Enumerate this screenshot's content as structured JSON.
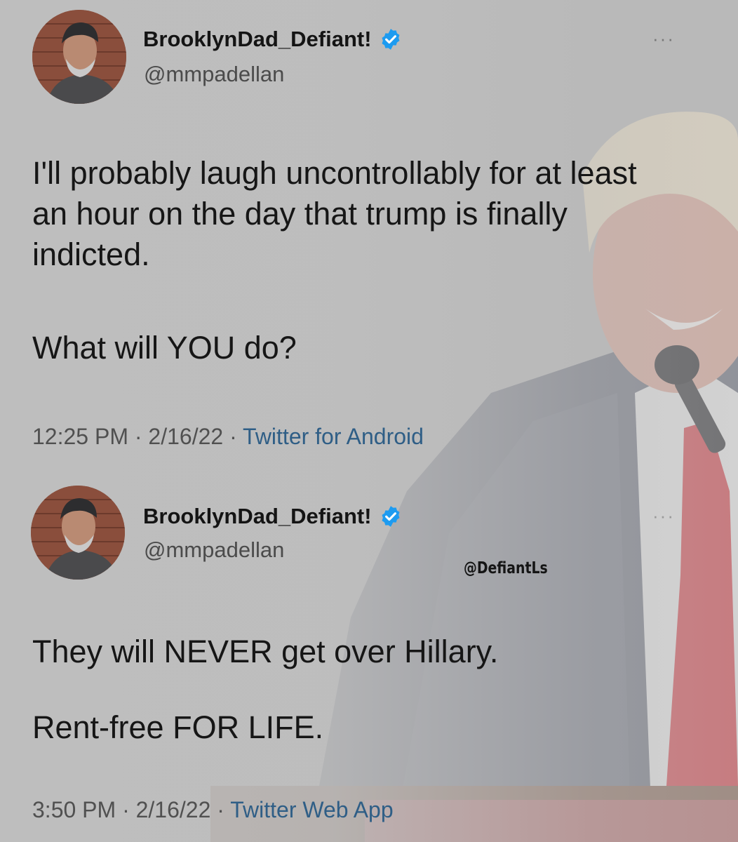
{
  "tweets": [
    {
      "display_name": "BrooklynDad_Defiant!",
      "handle": "@mmpadellan",
      "paragraphs": [
        "I'll probably laugh uncontrollably for at least an hour on the day that trump is finally indicted.",
        "What will YOU do?"
      ],
      "time": "12:25 PM",
      "date": "2/16/22",
      "separator": "·",
      "source": "Twitter for Android",
      "more": "···"
    },
    {
      "display_name": "BrooklynDad_Defiant!",
      "handle": "@mmpadellan",
      "paragraphs": [
        "They will NEVER get over Hillary.",
        "Rent-free FOR LIFE."
      ],
      "time": "3:50 PM",
      "date": "2/16/22",
      "separator": "·",
      "source": "Twitter Web App",
      "more": "···"
    }
  ],
  "watermark": "@DefiantLs",
  "colors": {
    "verified_badge": "#1d9bf0",
    "source_link": "#2f5e86",
    "background": "#b9b9b9"
  },
  "icons": {
    "verified": "verified-badge-icon",
    "more": "more-options-icon"
  }
}
